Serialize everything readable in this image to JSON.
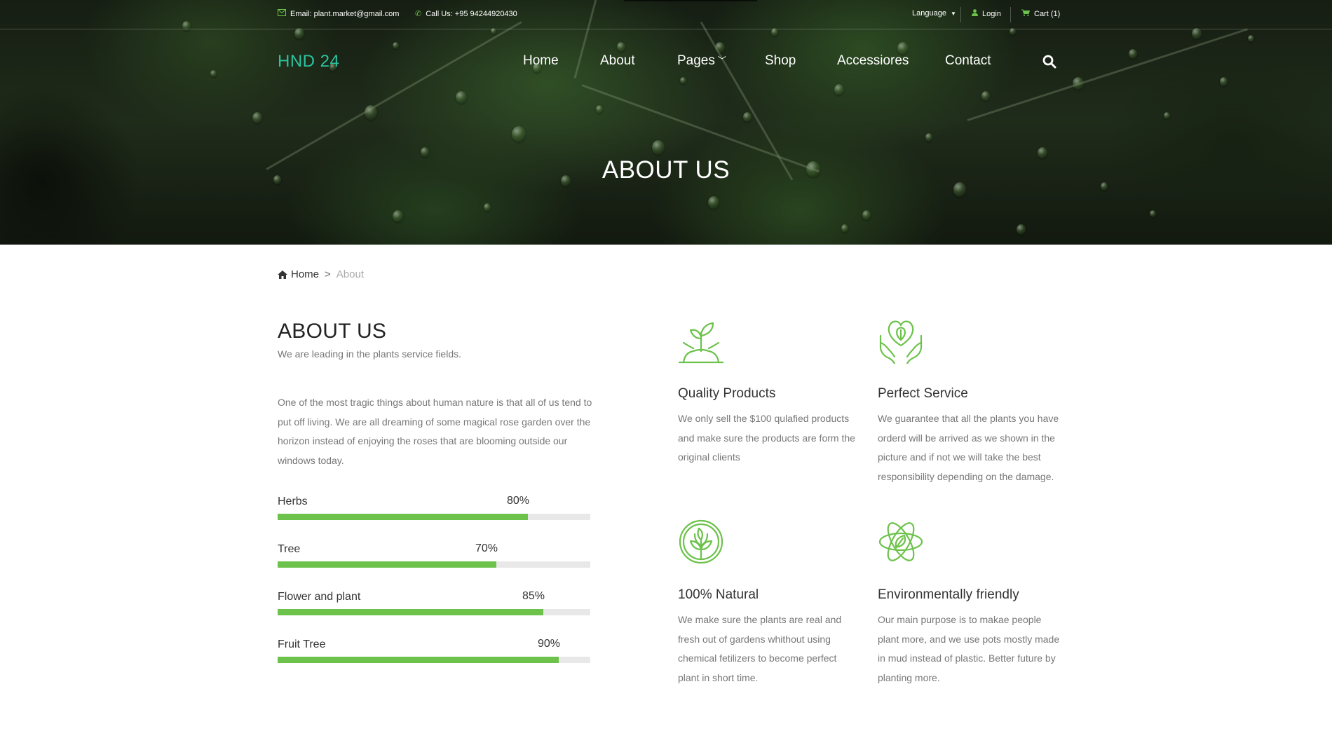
{
  "topbar": {
    "email": "Email: plant.market@gmail.com",
    "phone": "Call Us: +95 94244920430",
    "language": "Language",
    "login": "Login",
    "cart": "Cart (1)"
  },
  "brand": {
    "logo": "HND 24",
    "accent_color": "#6cc24a",
    "logo_color": "#2bc4a0"
  },
  "nav": {
    "items": [
      "Home",
      "About",
      "Pages",
      "Shop",
      "Accessiores",
      "Contact"
    ],
    "search_icon": "search-icon"
  },
  "hero": {
    "title": "ABOUT US"
  },
  "breadcrumb": {
    "home": "Home",
    "separator": ">",
    "current": "About"
  },
  "about": {
    "title": "ABOUT US",
    "subtitle": "We are leading in the plants service fields.",
    "text": "One of the most tragic things about human nature is that all of us tend to put off living. We are all dreaming of some magical rose garden over the horizon instead of enjoying the roses that are blooming outside our windows today."
  },
  "skills": [
    {
      "label": "Herbs",
      "percent": 80,
      "percent_text": "80%"
    },
    {
      "label": "Tree",
      "percent": 70,
      "percent_text": "70%"
    },
    {
      "label": "Flower and plant",
      "percent": 85,
      "percent_text": "85%"
    },
    {
      "label": "Fruit Tree",
      "percent": 90,
      "percent_text": "90%"
    }
  ],
  "features": [
    {
      "icon": "sprout-icon",
      "title": "Quality Products",
      "text": "We only sell the $100 qulafied products and make sure the products are form the original clients"
    },
    {
      "icon": "heart-hands-leaf-icon",
      "title": "Perfect Service",
      "text": "We guarantee that all the plants you have orderd will be arrived as we shown in the picture and if not we will take the best responsibility depending on the damage."
    },
    {
      "icon": "natural-leaves-icon",
      "title": "100% Natural",
      "text": "We make sure the plants are real and fresh out of gardens whithout using chemical fetilizers to become perfect plant in short time."
    },
    {
      "icon": "eco-atom-leaf-icon",
      "title": "Environmentally friendly",
      "text": "Our main purpose is to makae people plant more, and we use pots mostly made in mud instead of plastic. Better future by planting more."
    }
  ]
}
